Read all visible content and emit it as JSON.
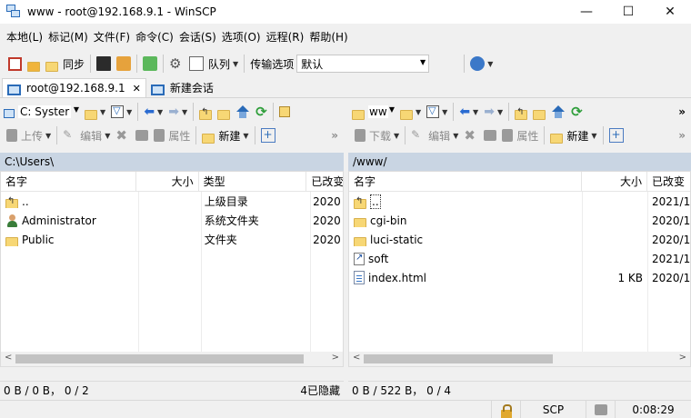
{
  "window": {
    "title": "www - root@192.168.9.1 - WinSCP",
    "min": "—",
    "max": "☐",
    "close": "✕"
  },
  "menu": [
    "本地(L)",
    "标记(M)",
    "文件(F)",
    "命令(C)",
    "会话(S)",
    "选项(O)",
    "远程(R)",
    "帮助(H)"
  ],
  "toolbar": {
    "sync_label": "同步",
    "queue_label": "队列",
    "transfer_label": "传输选项",
    "transfer_value": "默认"
  },
  "tabs": {
    "session": "root@192.168.9.1",
    "new_session": "新建会话"
  },
  "left": {
    "drive": "C: Syster",
    "upload": "上传",
    "edit": "编辑",
    "props": "属性",
    "new": "新建",
    "path": "C:\\Users\\",
    "headers": {
      "name": "名字",
      "size": "大小",
      "type": "类型",
      "changed": "已改变"
    },
    "rows": [
      {
        "name": "..",
        "type": "上级目录",
        "changed": "2020"
      },
      {
        "name": "Administrator",
        "type": "系统文件夹",
        "changed": "2020"
      },
      {
        "name": "Public",
        "type": "文件夹",
        "changed": "2020"
      }
    ],
    "status": "0 B / 0 B，  0 / 2",
    "hidden": "4已隐藏"
  },
  "right": {
    "dir": "ww",
    "download": "下载",
    "edit": "编辑",
    "props": "属性",
    "new": "新建",
    "path": "/www/",
    "headers": {
      "name": "名字",
      "size": "大小",
      "changed": "已改变"
    },
    "rows": [
      {
        "name": "..",
        "size": "",
        "changed": "2021/1/"
      },
      {
        "name": "cgi-bin",
        "size": "",
        "changed": "2020/1/"
      },
      {
        "name": "luci-static",
        "size": "",
        "changed": "2020/1/"
      },
      {
        "name": "soft",
        "size": "",
        "changed": "2021/1/"
      },
      {
        "name": "index.html",
        "size": "1 KB",
        "changed": "2020/1/"
      }
    ],
    "status": "0 B / 522 B，  0 / 4"
  },
  "statusbar": {
    "protocol": "SCP",
    "time": "0:08:29"
  }
}
